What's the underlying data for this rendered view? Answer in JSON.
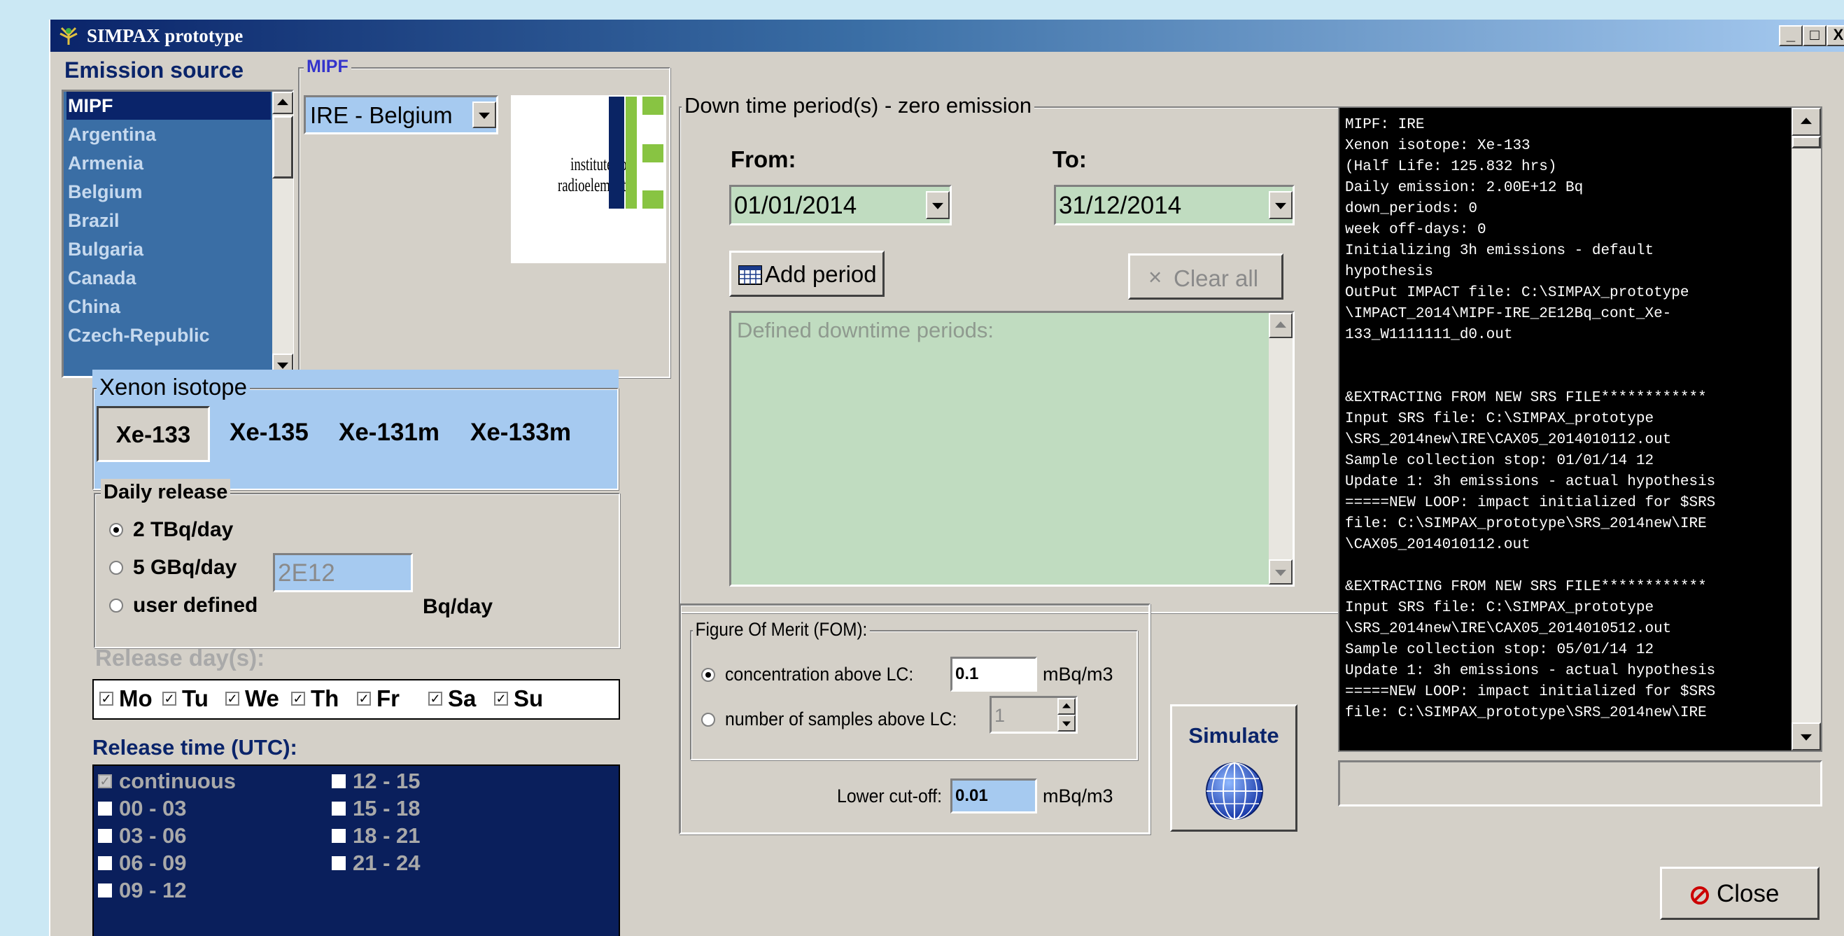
{
  "window": {
    "title": "SIMPAX prototype",
    "min_label": "_",
    "max_label": "□",
    "close_label": "X"
  },
  "emission_source": {
    "heading": "Emission source",
    "items": [
      "MIPF",
      "Argentina",
      "Armenia",
      "Belgium",
      "Brazil",
      "Bulgaria",
      "Canada",
      "China",
      "Czech-Republic"
    ],
    "selected": "MIPF"
  },
  "mipf": {
    "legend": "MIPF",
    "facility_selected": "IRE - Belgium",
    "logo_text_line1": "institute for",
    "logo_text_line2": "radioelements"
  },
  "xenon": {
    "legend": "Xenon isotope",
    "isotopes": [
      "Xe-133",
      "Xe-135",
      "Xe-131m",
      "Xe-133m"
    ],
    "selected": "Xe-133"
  },
  "daily_release": {
    "legend": "Daily release",
    "options": [
      "2 TBq/day",
      "5 GBq/day",
      "user defined"
    ],
    "selected": "2 TBq/day",
    "value": "2E12",
    "unit": "Bq/day"
  },
  "release_days": {
    "label": "Release day(s):",
    "days": [
      "Mo",
      "Tu",
      "We",
      "Th",
      "Fr",
      "Sa",
      "Su"
    ]
  },
  "release_time": {
    "label": "Release time (UTC):",
    "col1": [
      "continuous",
      "00 - 03",
      "03 - 06",
      "06 - 09",
      "09 - 12"
    ],
    "col2": [
      "12 - 15",
      "15 - 18",
      "18 - 21",
      "21 - 24"
    ]
  },
  "downtime": {
    "legend": "Down time period(s) - zero emission",
    "from_label": "From:",
    "to_label": "To:",
    "from_value": "01/01/2014",
    "to_value": "31/12/2014",
    "add_label": "Add period",
    "clear_label": "Clear all",
    "clear_icon": "×",
    "periods_placeholder": "Defined downtime periods:"
  },
  "fom": {
    "legend": "Figure Of Merit (FOM):",
    "opt1_label": "concentration above LC:",
    "opt1_value": "0.1",
    "opt1_unit": "mBq/m3",
    "opt2_label": "number of samples above LC:",
    "opt2_value": "1",
    "cutoff_label": "Lower cut-off:",
    "cutoff_value": "0.01",
    "cutoff_unit": "mBq/m3"
  },
  "simulate": {
    "label": "Simulate"
  },
  "console": {
    "lines": [
      "MIPF: IRE",
      "Xenon isotope: Xe-133",
      "(Half Life: 125.832 hrs)",
      "Daily emission: 2.00E+12 Bq",
      "down_periods: 0",
      "week off-days: 0",
      "Initializing 3h emissions - default",
      "hypothesis",
      "OutPut IMPACT file: C:\\SIMPAX_prototype",
      "\\IMPACT_2014\\MIPF-IRE_2E12Bq_cont_Xe-",
      "133_W1111111_d0.out",
      "",
      "",
      "&EXTRACTING FROM NEW SRS FILE************",
      "Input SRS file: C:\\SIMPAX_prototype",
      "\\SRS_2014new\\IRE\\CAX05_2014010112.out",
      "Sample collection stop: 01/01/14 12",
      "Update 1: 3h emissions - actual hypothesis",
      "=====NEW LOOP: impact initialized for $SRS",
      "file: C:\\SIMPAX_prototype\\SRS_2014new\\IRE",
      "\\CAX05_2014010112.out",
      "",
      "&EXTRACTING FROM NEW SRS FILE************",
      "Input SRS file: C:\\SIMPAX_prototype",
      "\\SRS_2014new\\IRE\\CAX05_2014010512.out",
      "Sample collection stop: 05/01/14 12",
      "Update 1: 3h emissions - actual hypothesis",
      "=====NEW LOOP: impact initialized for $SRS",
      "file: C:\\SIMPAX_prototype\\SRS_2014new\\IRE"
    ]
  },
  "close": {
    "label": "Close"
  },
  "colors": {
    "titlebar_start": "#0a246a",
    "list_bg": "#3a6ea5",
    "periods_bg": "#c0dcc0",
    "release_time_bg": "#0a1f5c",
    "xenon_bg": "#a6caf0",
    "console_bg": "#000000"
  }
}
